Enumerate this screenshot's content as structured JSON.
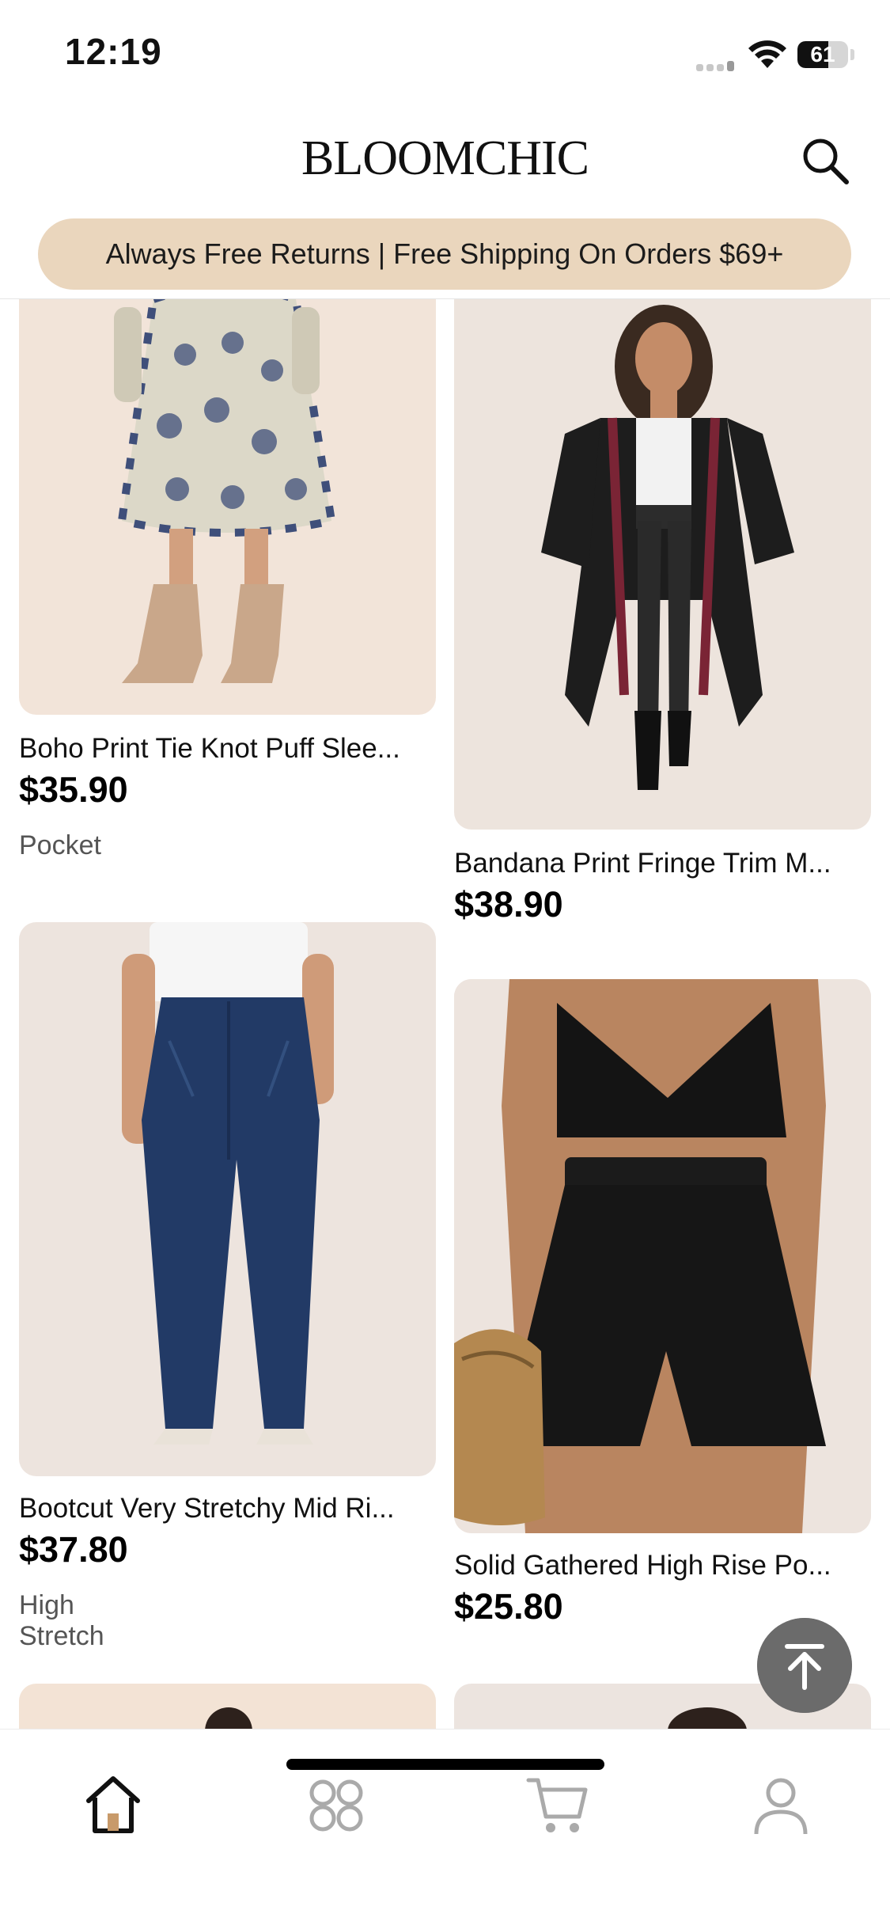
{
  "status_bar": {
    "time": "12:19",
    "battery": "61",
    "battery_level": 0.61
  },
  "header": {
    "logo": "BLOOMCHIC",
    "search_icon": "search-icon"
  },
  "banner": {
    "text": "Always Free Returns | Free Shipping On Orders $69+"
  },
  "products": [
    {
      "title": "Boho Print Tie Knot Puff Slee...",
      "price": "$35.90",
      "tag": "Pocket"
    },
    {
      "title": "Bandana Print Fringe Trim M...",
      "price": "$38.90",
      "tag": ""
    },
    {
      "title": "Bootcut Very Stretchy Mid Ri...",
      "price": "$37.80",
      "tag": "High Stretch"
    },
    {
      "title": "Solid Gathered High Rise Po...",
      "price": "$25.80",
      "tag": ""
    }
  ],
  "scroll_top": {
    "icon": "arrow-up-to-top-icon"
  },
  "tabbar": {
    "tabs": [
      {
        "icon": "home-icon",
        "active": true
      },
      {
        "icon": "category-icon",
        "active": false
      },
      {
        "icon": "cart-icon",
        "active": false
      },
      {
        "icon": "profile-icon",
        "active": false
      }
    ]
  },
  "colors": {
    "banner_bg": "#ead6bd",
    "image_bg": "#efe4dc",
    "scroll_button": "#6b6b6b"
  }
}
